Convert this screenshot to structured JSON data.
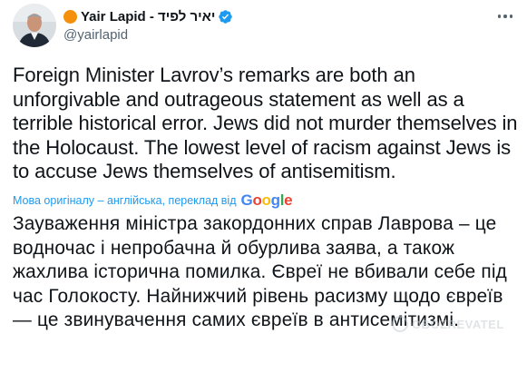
{
  "author": {
    "display_name": "Yair Lapid - יאיר לפיד",
    "handle": "@yairlapid",
    "emoji": "orange-circle",
    "verified": true
  },
  "tweet": {
    "text": "Foreign Minister Lavrov’s remarks are both an unforgivable and outrageous statement as well as a terrible historical error. Jews did not murder themselves in the Holocaust. The lowest level of racism against Jews is to accuse Jews themselves of antisemitism."
  },
  "translation": {
    "notice": "Мова оригіналу – англійська, переклад від",
    "provider_letters": [
      "G",
      "o",
      "o",
      "g",
      "l",
      "e"
    ],
    "text": "Зауваження міністра закордонних справ Лаврова – це водночас і непробачна й обурлива заява, а також жахлива історична помилка. Євреї не вбивали себе під час Голокосту. Найнижчий рівень расизму щодо євреїв — це звинувачення самих євреїв в антисемітизмі."
  },
  "watermark": {
    "text": "OBOZREVATEL"
  },
  "colors": {
    "text": "#0f1419",
    "secondary": "#536471",
    "link": "#1d9bf0",
    "verified": "#1d9bf0",
    "emoji": "#f4900c"
  }
}
